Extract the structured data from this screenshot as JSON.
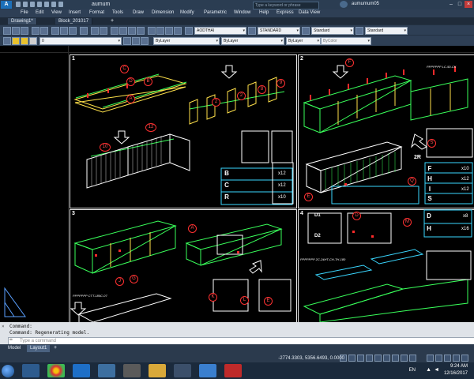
{
  "titlebar": {
    "doc_title": "aumum",
    "search_placeholder": "Type a keyword or phrase",
    "user_name": "aumumum05"
  },
  "menu": [
    "File",
    "Edit",
    "View",
    "Insert",
    "Format",
    "Tools",
    "Draw",
    "Dimension",
    "Modify",
    "Parametric",
    "Window",
    "Help",
    "Express",
    "Data View"
  ],
  "doc_tabs": [
    "Drawing1*",
    "Block_201017"
  ],
  "toolbar1": {
    "text_style": "AODTHAI",
    "dim_style": "STANDARD",
    "table_style": "Standard",
    "mleader_style": "Standard"
  },
  "toolbar2": {
    "layer": "0",
    "color": "ByLayer",
    "linetype": "ByLayer",
    "lineweight": "ByLayer",
    "plotstyle": "ByColor"
  },
  "drawing": {
    "panels": [
      "1",
      "2",
      "3",
      "4"
    ],
    "panel1_callouts": [
      "C",
      "D",
      "B",
      "A",
      "2",
      "2",
      "8",
      "9",
      "10",
      "12"
    ],
    "panel1_legend": [
      {
        "letter": "B",
        "qty": "x12"
      },
      {
        "letter": "C",
        "qty": "x12"
      },
      {
        "letter": "R",
        "qty": "x10"
      }
    ],
    "panel2_callouts": [
      "F",
      "S",
      "2R",
      "Q",
      "E"
    ],
    "panel2_legend": [
      {
        "letter": "F",
        "qty": "x10"
      },
      {
        "letter": "H",
        "qty": "x12"
      },
      {
        "letter": "I",
        "qty": "x12"
      },
      {
        "letter": "S",
        "qty": ""
      }
    ],
    "panel3_callouts": [
      "A",
      "J",
      "G",
      "K",
      "L",
      "E"
    ],
    "panel4_callouts": [
      "D1",
      "D2",
      "D",
      "M"
    ],
    "panel4_legend": [
      {
        "letter": "D",
        "qty": "x8"
      },
      {
        "letter": "H",
        "qty": "x16"
      }
    ],
    "part_codes": [
      "PPPPPPP LC-50-CK",
      "PPPPPPP CTT-180C-07",
      "PPPPPPP 2C-24HT-CH-TH-180"
    ]
  },
  "command": {
    "line1": "Command:",
    "line2": "Command: Regenerating model.",
    "input_placeholder": "Type a command"
  },
  "layout_tabs": [
    "Model",
    "Layout1"
  ],
  "status": {
    "coords": "-2774.3303, 5356.6493, 0.0000"
  },
  "taskbar": {
    "lang": "EN",
    "time": "9:24 AM",
    "date": "12/16/2017"
  },
  "colors": {
    "titlebar": "#2b3d52",
    "canvas": "#000000",
    "frame": "#e8e8e8",
    "accent_cyan": "#3ad7ff",
    "callout_red": "#ff3030"
  }
}
